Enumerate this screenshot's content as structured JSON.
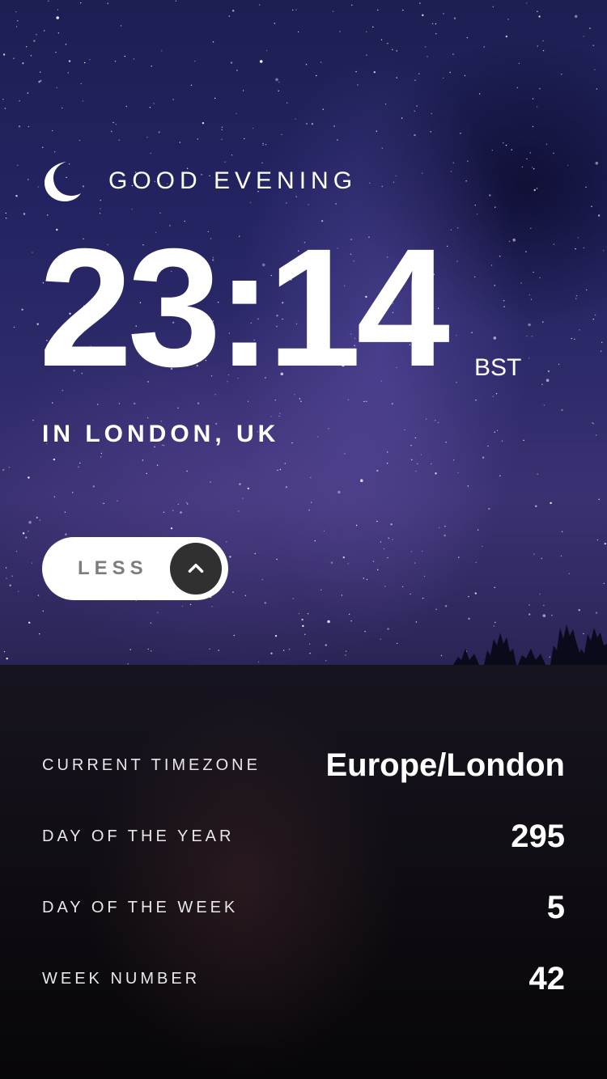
{
  "greeting": {
    "text": "GOOD EVENING",
    "icon": "moon-icon"
  },
  "clock": {
    "time": "23:14",
    "timezone_abbr": "BST",
    "location": "IN LONDON, UK"
  },
  "toggle": {
    "label": "LESS",
    "icon": "chevron-up-icon"
  },
  "details": [
    {
      "label": "CURRENT TIMEZONE",
      "value": "Europe/London"
    },
    {
      "label": "DAY OF THE YEAR",
      "value": "295"
    },
    {
      "label": "DAY OF THE WEEK",
      "value": "5"
    },
    {
      "label": "WEEK NUMBER",
      "value": "42"
    }
  ],
  "colors": {
    "sky_top": "#1c1f52",
    "sky_bottom": "#3a3172",
    "panel_bg": "#110e16",
    "button_bg": "#ffffff",
    "button_text": "#7d7d7d",
    "arrow_bg": "#303030",
    "text": "#ffffff"
  }
}
